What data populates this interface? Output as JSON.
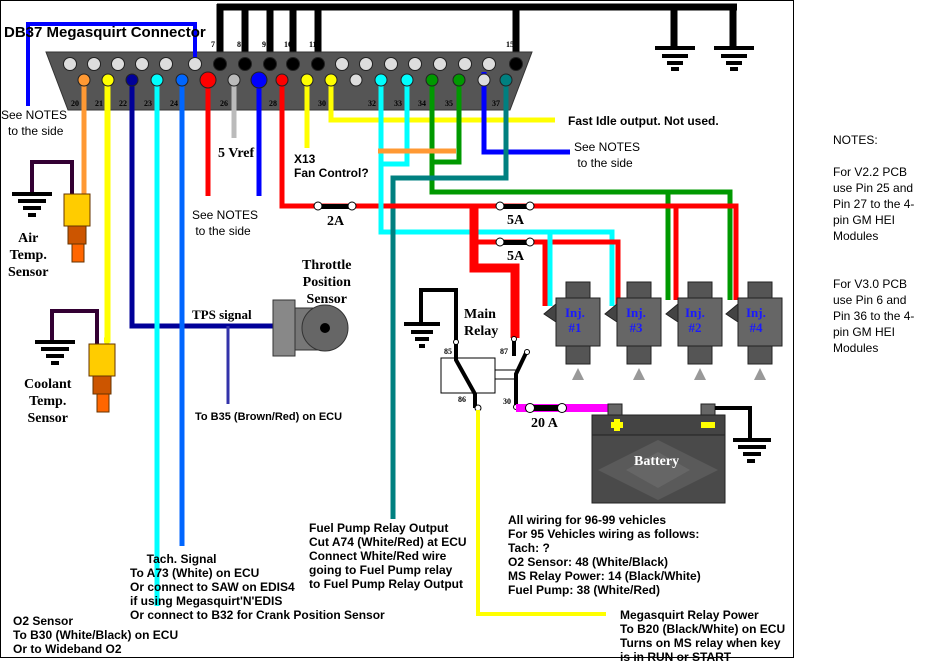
{
  "title": "DB37 Megasquirt Connector",
  "connector": {
    "top_pin_labels": [
      "7",
      "8",
      "9",
      "10",
      "11",
      "15"
    ],
    "bottom_pin_labels": [
      "20",
      "21",
      "22",
      "23",
      "24",
      "26",
      "28",
      "30",
      "32",
      "33",
      "34",
      "35",
      "37"
    ]
  },
  "labels": {
    "see_notes_1": "See NOTES\n to the side",
    "see_notes_2": "See NOTES\n to the side",
    "see_notes_3": "See NOTES\n to the side",
    "vref": "5 Vref",
    "fan": "X13\nFan Control?",
    "fast_idle": "Fast Idle output. Not used.",
    "air_temp": "Air\nTemp.\nSensor",
    "coolant_temp": "Coolant\nTemp.\nSensor",
    "tps_title": "Throttle\nPosition\nSensor",
    "tps_signal": "TPS signal",
    "tps_b35": "To B35 (Brown/Red) on ECU",
    "main_relay": "Main\nRelay",
    "relay_pin_85": "85",
    "relay_pin_86": "86",
    "relay_pin_87": "87",
    "relay_pin_30": "30",
    "fuse_2a": "2A",
    "fuse_5a_1": "5A",
    "fuse_5a_2": "5A",
    "fuse_20a": "20 A",
    "battery": "Battery",
    "fuel_pump": "Fuel Pump Relay Output\nCut A74 (White/Red) at ECU\nConnect White/Red wire\ngoing to Fuel Pump relay\nto Fuel Pump Relay Output",
    "tach": "     Tach. Signal\nTo A73 (White) on ECU\nOr connect to SAW on EDIS4\nif using Megasquirt'N'EDIS\nOr connect to B32 for Crank Position Sensor",
    "o2": "O2 Sensor\nTo B30 (White/Black) on ECU\nOr to Wideband O2",
    "vehicles": "All wiring for 96-99 vehicles\nFor 95 Vehicles wiring as follows:\nTach: ?\nO2 Sensor: 48 (White/Black)\nMS Relay Power: 14 (Black/White)\nFuel Pump: 38 (White/Red)",
    "ms_relay_power": "Megasquirt Relay Power\nTo B20 (Black/White) on ECU\nTurns on MS relay when key\nis in RUN or START"
  },
  "injectors": [
    {
      "name": "Inj.\n#1"
    },
    {
      "name": "Inj.\n#3"
    },
    {
      "name": "Inj.\n#2"
    },
    {
      "name": "Inj.\n#4"
    }
  ],
  "notes": "NOTES:\n\nFor V2.2 PCB\nuse Pin 25 and\nPin 27 to the 4-\npin GM HEI\nModules\n\n\nFor V3.0 PCB\nuse Pin 6 and\nPin 36 to the 4-\npin GM HEI\nModules",
  "colors": {
    "orange": "#ff9933",
    "yellow": "#ffff00",
    "navy": "#000099",
    "cyan": "#00ffff",
    "light_blue": "#0066ff",
    "red": "#ff0000",
    "gray": "#bbbbbb",
    "blue": "#0000ff",
    "green": "#009900",
    "teal": "#008080",
    "magenta": "#ff00ff",
    "black": "#000000"
  }
}
